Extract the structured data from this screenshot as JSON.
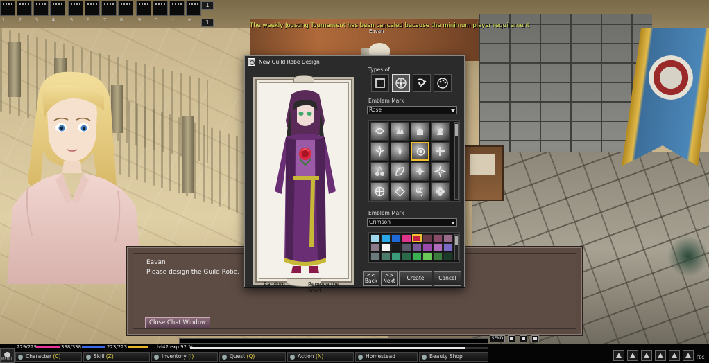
{
  "system_message": "The weekly Jousting Tournament has been canceled because the minimum player requirement",
  "npc_nameplate": "Eavan",
  "hotbar": {
    "slot_numbers": [
      "1",
      "2",
      "3",
      "4",
      "5",
      "6",
      "7",
      "8",
      "9",
      "0",
      "-",
      "+"
    ],
    "page_labels": [
      "1",
      "1"
    ]
  },
  "robe_dialog": {
    "title": "New Guild Robe Design",
    "types_label": "Types of",
    "type_icons": [
      "square-outline-icon",
      "flower-emblem-icon",
      "swirl-icon",
      "palette-icon"
    ],
    "emblem_label": "Emblem Mark",
    "emblem_selected": "Rose",
    "color_label": "Emblem Mark",
    "color_selected": "Crimson",
    "random_label": "Random",
    "hood_label": "Remove the hood",
    "buttons": {
      "back_top": "<<",
      "back": "Back",
      "next_top": ">>",
      "next": "Next",
      "create": "Create",
      "cancel": "Cancel"
    },
    "swatch_colors": [
      "#9fd8ee",
      "#2aa8e8",
      "#1e6ad8",
      "#e0348a",
      "#c82040",
      "#6a3a4a",
      "#8a4a6a",
      "#9a6a8a",
      "#8a7a8a",
      "#f4f4f4",
      "#1a1a1a",
      "#5a5a6a",
      "#7a5a9a",
      "#9a4aaa",
      "#b06abb",
      "#7a6ac8",
      "#6a7a7a",
      "#4a7a6a",
      "#3a9a7a",
      "#2a6a4a",
      "#3ab050",
      "#6ac858",
      "#3a7a3a",
      "#1a3a2a"
    ],
    "selected_swatch_index": 4,
    "selected_emblem_index": 6
  },
  "chat": {
    "speaker": "Eavan",
    "message": "Please design the Guild Robe.",
    "close_button": "Close Chat Window"
  },
  "status": {
    "hp": "229/229",
    "mp": "338/338",
    "sp": "223/223",
    "level_exp": "lvl42 exp 92 %",
    "exp_percent": 92,
    "send_label": "SEND",
    "hp_color": "#e8339a",
    "mp_color": "#3a6ae8",
    "sp_color": "#e8b828"
  },
  "menu": {
    "items": [
      {
        "label": "Character",
        "hotkey": "(C)"
      },
      {
        "label": "Skill",
        "hotkey": "(Z)"
      },
      {
        "label": "Inventory",
        "hotkey": "(I)"
      },
      {
        "label": "Quest",
        "hotkey": "(Q)"
      },
      {
        "label": "Action",
        "hotkey": "(N)"
      },
      {
        "label": "Homestead",
        "hotkey": ""
      },
      {
        "label": "Beauty Shop",
        "hotkey": ""
      }
    ],
    "corner_label": "MENU",
    "tray_label": "FEC"
  }
}
